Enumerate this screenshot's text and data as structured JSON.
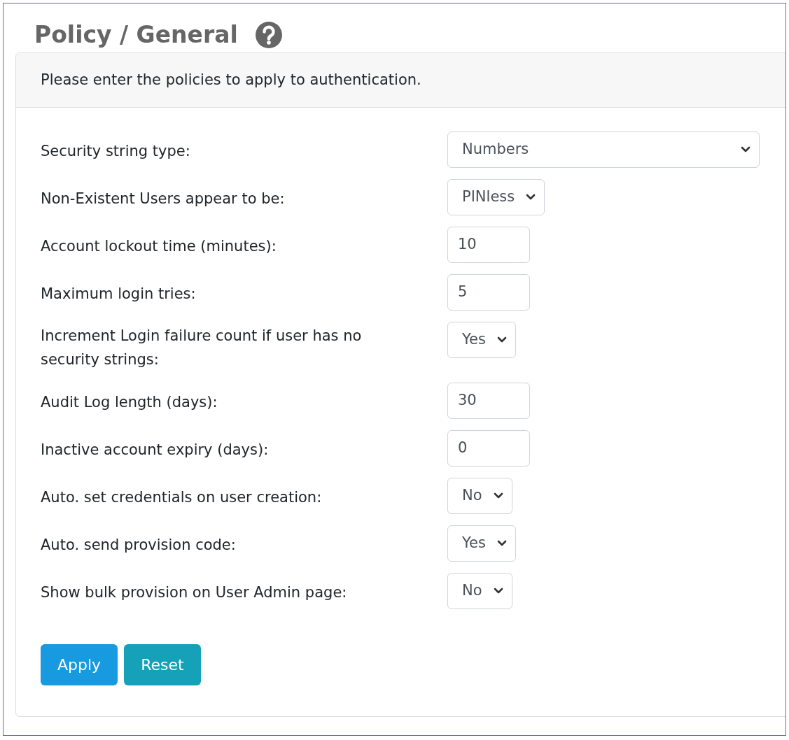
{
  "page": {
    "title": "Policy / General"
  },
  "card": {
    "intro": "Please enter the policies to apply to authentication."
  },
  "fields": [
    {
      "label": "Security string type:",
      "kind": "wide-select",
      "value": "Numbers"
    },
    {
      "label": "Non-Existent Users appear to be:",
      "kind": "select",
      "value": "PINless"
    },
    {
      "label": "Account lockout time (minutes):",
      "kind": "input",
      "value": "10"
    },
    {
      "label": "Maximum login tries:",
      "kind": "input",
      "value": "5"
    },
    {
      "label": "Increment Login failure count if user has no security strings:",
      "kind": "select",
      "value": "Yes"
    },
    {
      "label": "Audit Log length (days):",
      "kind": "input",
      "value": "30"
    },
    {
      "label": "Inactive account expiry (days):",
      "kind": "input",
      "value": "0"
    },
    {
      "label": "Auto. set credentials on user creation:",
      "kind": "select",
      "value": "No"
    },
    {
      "label": "Auto. send provision code:",
      "kind": "select",
      "value": "Yes"
    },
    {
      "label": "Show bulk provision on User Admin page:",
      "kind": "select",
      "value": "No"
    }
  ],
  "buttons": [
    {
      "label": "Apply",
      "kind": "primary"
    },
    {
      "label": "Reset",
      "kind": "secondary"
    }
  ]
}
